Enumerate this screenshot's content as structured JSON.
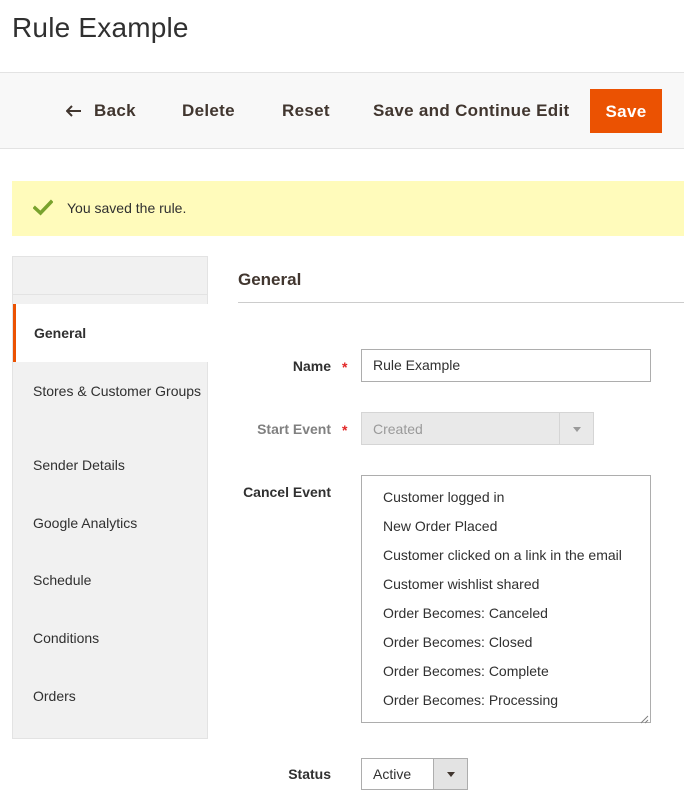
{
  "page": {
    "title": "Rule Example"
  },
  "toolbar": {
    "back_label": "Back",
    "delete_label": "Delete",
    "reset_label": "Reset",
    "save_continue_label": "Save and Continue Edit",
    "save_label": "Save"
  },
  "message": {
    "text": "You saved the rule.",
    "type": "success"
  },
  "tabs": [
    {
      "label": "General",
      "active": true
    },
    {
      "label": "Stores & Customer Groups"
    },
    {
      "label": "Sender Details"
    },
    {
      "label": "Google Analytics"
    },
    {
      "label": "Schedule"
    },
    {
      "label": "Conditions"
    },
    {
      "label": "Orders"
    }
  ],
  "section": {
    "title": "General"
  },
  "form": {
    "name_label": "Name",
    "name_value": "Rule Example",
    "required_mark": "*",
    "start_event_label": "Start Event",
    "start_event_value": "Created",
    "cancel_event_label": "Cancel Event",
    "cancel_event_options": [
      "Customer logged in",
      "New Order Placed",
      "Customer clicked on a link in the email",
      "Customer wishlist shared",
      "Order Becomes: Canceled",
      "Order Becomes: Closed",
      "Order Becomes: Complete",
      "Order Becomes: Processing"
    ],
    "status_label": "Status",
    "status_value": "Active"
  },
  "colors": {
    "accent": "#eb5202",
    "message_bg": "#fffbbb",
    "success_icon": "#79a22e",
    "required": "#e22626"
  },
  "icons": {
    "back": "arrow-left-icon",
    "message": "check-icon",
    "dropdown": "chevron-down-icon"
  }
}
